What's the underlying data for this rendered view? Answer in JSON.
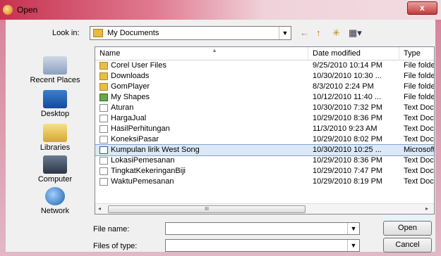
{
  "window": {
    "title": "Open",
    "close_glyph": "x"
  },
  "lookin": {
    "label": "Look in:",
    "value": "My Documents"
  },
  "toolbar": {
    "back_glyph": "←",
    "up_glyph": "↑",
    "newfolder_glyph": "✳",
    "views_glyph": "▦▾"
  },
  "places": [
    "Recent Places",
    "Desktop",
    "Libraries",
    "Computer",
    "Network"
  ],
  "columns": {
    "name": "Name",
    "date": "Date modified",
    "type": "Type"
  },
  "files": [
    {
      "name": "Corel User Files",
      "date": "9/25/2010 10:14 PM",
      "type": "File folder",
      "icon": "folder"
    },
    {
      "name": "Downloads",
      "date": "10/30/2010 10:30 ...",
      "type": "File folder",
      "icon": "folder"
    },
    {
      "name": "GomPlayer",
      "date": "8/3/2010 2:24 PM",
      "type": "File folder",
      "icon": "folder"
    },
    {
      "name": "My Shapes",
      "date": "10/12/2010 11:40 ...",
      "type": "File folder",
      "icon": "shapes"
    },
    {
      "name": "Aturan",
      "date": "10/30/2010 7:32 PM",
      "type": "Text Docu",
      "icon": "txt"
    },
    {
      "name": "HargaJual",
      "date": "10/29/2010 8:36 PM",
      "type": "Text Docu",
      "icon": "txt"
    },
    {
      "name": "HasilPerhitungan",
      "date": "11/3/2010 9:23 AM",
      "type": "Text Docu",
      "icon": "txt"
    },
    {
      "name": "KoneksiPasar",
      "date": "10/29/2010 8:02 PM",
      "type": "Text Docu",
      "icon": "txt"
    },
    {
      "name": "Kumpulan lirik West Song",
      "date": "10/30/2010 10:25 ...",
      "type": "Microsoft",
      "icon": "word",
      "selected": true
    },
    {
      "name": "LokasiPemesanan",
      "date": "10/29/2010 8:36 PM",
      "type": "Text Docu",
      "icon": "txt"
    },
    {
      "name": "TingkatKekeringanBiji",
      "date": "10/29/2010 7:47 PM",
      "type": "Text Docu",
      "icon": "txt"
    },
    {
      "name": "WaktuPemesanan",
      "date": "10/29/2010 8:19 PM",
      "type": "Text Docu",
      "icon": "txt"
    }
  ],
  "scroll": {
    "thumb_glyph": "III",
    "left_glyph": "◂",
    "right_glyph": "▸"
  },
  "filename": {
    "label": "File name:",
    "value": ""
  },
  "filetype": {
    "label": "Files of type:",
    "value": ""
  },
  "buttons": {
    "open": "Open",
    "cancel": "Cancel"
  },
  "colors": {
    "title_accent": "#c73250",
    "selection": "#dbe8f7"
  }
}
